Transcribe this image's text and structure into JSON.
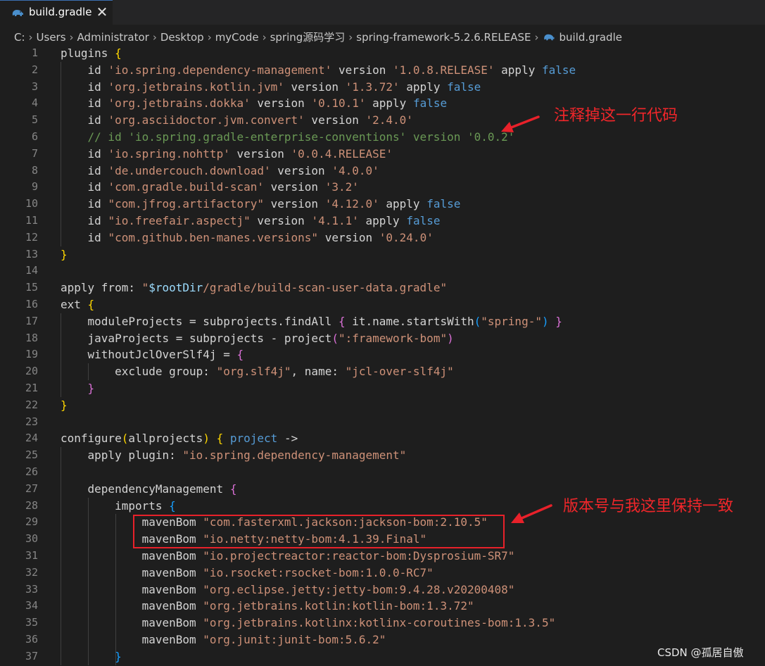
{
  "tab": {
    "file_name": "build.gradle",
    "close_glyph": "✕",
    "icon": "gradle-elephant-icon"
  },
  "breadcrumb": [
    "C:",
    "Users",
    "Administrator",
    "Desktop",
    "myCode",
    "spring源码学习",
    "spring-framework-5.2.6.RELEASE",
    "build.gradle"
  ],
  "colors": {
    "keyword": "#569cd6",
    "string": "#ce9178",
    "comment": "#6a9955",
    "annotation": "#f0262a"
  },
  "annotations": [
    {
      "text": "注释掉这一行代码",
      "target_line": 6
    },
    {
      "text": "版本号与我这里保持一致",
      "target_lines": [
        29,
        30
      ]
    }
  ],
  "watermark": "CSDN @孤居自傲",
  "code_lines": [
    [
      [
        "o",
        "plugins "
      ],
      [
        "b1",
        "{"
      ]
    ],
    [
      [
        "o",
        "    id "
      ],
      [
        "s",
        "'io.spring.dependency-management'"
      ],
      [
        "o",
        " version "
      ],
      [
        "s",
        "'1.0.8.RELEASE'"
      ],
      [
        "o",
        " apply "
      ],
      [
        "kw",
        "false"
      ]
    ],
    [
      [
        "o",
        "    id "
      ],
      [
        "s",
        "'org.jetbrains.kotlin.jvm'"
      ],
      [
        "o",
        " version "
      ],
      [
        "s",
        "'1.3.72'"
      ],
      [
        "o",
        " apply "
      ],
      [
        "kw",
        "false"
      ]
    ],
    [
      [
        "o",
        "    id "
      ],
      [
        "s",
        "'org.jetbrains.dokka'"
      ],
      [
        "o",
        " version "
      ],
      [
        "s",
        "'0.10.1'"
      ],
      [
        "o",
        " apply "
      ],
      [
        "kw",
        "false"
      ]
    ],
    [
      [
        "o",
        "    id "
      ],
      [
        "s",
        "'org.asciidoctor.jvm.convert'"
      ],
      [
        "o",
        " version "
      ],
      [
        "s",
        "'2.4.0'"
      ]
    ],
    [
      [
        "o",
        "    "
      ],
      [
        "c",
        "// id 'io.spring.gradle-enterprise-conventions' version '0.0.2'"
      ]
    ],
    [
      [
        "o",
        "    id "
      ],
      [
        "s",
        "'io.spring.nohttp'"
      ],
      [
        "o",
        " version "
      ],
      [
        "s",
        "'0.0.4.RELEASE'"
      ]
    ],
    [
      [
        "o",
        "    id "
      ],
      [
        "s",
        "'de.undercouch.download'"
      ],
      [
        "o",
        " version "
      ],
      [
        "s",
        "'4.0.0'"
      ]
    ],
    [
      [
        "o",
        "    id "
      ],
      [
        "s",
        "'com.gradle.build-scan'"
      ],
      [
        "o",
        " version "
      ],
      [
        "s",
        "'3.2'"
      ]
    ],
    [
      [
        "o",
        "    id "
      ],
      [
        "s",
        "\"com.jfrog.artifactory\""
      ],
      [
        "o",
        " version "
      ],
      [
        "s",
        "'4.12.0'"
      ],
      [
        "o",
        " apply "
      ],
      [
        "kw",
        "false"
      ]
    ],
    [
      [
        "o",
        "    id "
      ],
      [
        "s",
        "\"io.freefair.aspectj\""
      ],
      [
        "o",
        " version "
      ],
      [
        "s",
        "'4.1.1'"
      ],
      [
        "o",
        " apply "
      ],
      [
        "kw",
        "false"
      ]
    ],
    [
      [
        "o",
        "    id "
      ],
      [
        "s",
        "\"com.github.ben-manes.versions\""
      ],
      [
        "o",
        " version "
      ],
      [
        "s",
        "'0.24.0'"
      ]
    ],
    [
      [
        "b1",
        "}"
      ]
    ],
    [],
    [
      [
        "o",
        "apply from: "
      ],
      [
        "s",
        "\""
      ],
      [
        "v",
        "$rootDir"
      ],
      [
        "s",
        "/gradle/build-scan-user-data.gradle\""
      ]
    ],
    [
      [
        "o",
        "ext "
      ],
      [
        "b1",
        "{"
      ]
    ],
    [
      [
        "o",
        "    moduleProjects = subprojects.findAll "
      ],
      [
        "b2",
        "{"
      ],
      [
        "o",
        " it.name.startsWith"
      ],
      [
        "b3",
        "("
      ],
      [
        "s",
        "\"spring-\""
      ],
      [
        "b3",
        ")"
      ],
      [
        "o",
        " "
      ],
      [
        "b2",
        "}"
      ]
    ],
    [
      [
        "o",
        "    javaProjects = subprojects - project"
      ],
      [
        "b2",
        "("
      ],
      [
        "s",
        "\":framework-bom\""
      ],
      [
        "b2",
        ")"
      ]
    ],
    [
      [
        "o",
        "    withoutJclOverSlf4j = "
      ],
      [
        "b2",
        "{"
      ]
    ],
    [
      [
        "o",
        "        exclude group: "
      ],
      [
        "s",
        "\"org.slf4j\""
      ],
      [
        "o",
        ", name: "
      ],
      [
        "s",
        "\"jcl-over-slf4j\""
      ]
    ],
    [
      [
        "o",
        "    "
      ],
      [
        "b2",
        "}"
      ]
    ],
    [
      [
        "b1",
        "}"
      ]
    ],
    [],
    [
      [
        "o",
        "configure"
      ],
      [
        "b1",
        "("
      ],
      [
        "o",
        "allprojects"
      ],
      [
        "b1",
        ")"
      ],
      [
        "o",
        " "
      ],
      [
        "b1",
        "{"
      ],
      [
        "o",
        " "
      ],
      [
        "kw",
        "project"
      ],
      [
        "o",
        " ->"
      ]
    ],
    [
      [
        "o",
        "    apply plugin: "
      ],
      [
        "s",
        "\"io.spring.dependency-management\""
      ]
    ],
    [],
    [
      [
        "o",
        "    dependencyManagement "
      ],
      [
        "b2",
        "{"
      ]
    ],
    [
      [
        "o",
        "        imports "
      ],
      [
        "b3",
        "{"
      ]
    ],
    [
      [
        "o",
        "            mavenBom "
      ],
      [
        "s",
        "\"com.fasterxml.jackson:jackson-bom:2.10.5\""
      ]
    ],
    [
      [
        "o",
        "            mavenBom "
      ],
      [
        "s",
        "\"io.netty:netty-bom:4.1.39.Final\""
      ]
    ],
    [
      [
        "o",
        "            mavenBom "
      ],
      [
        "s",
        "\"io.projectreactor:reactor-bom:Dysprosium-SR7\""
      ]
    ],
    [
      [
        "o",
        "            mavenBom "
      ],
      [
        "s",
        "\"io.rsocket:rsocket-bom:1.0.0-RC7\""
      ]
    ],
    [
      [
        "o",
        "            mavenBom "
      ],
      [
        "s",
        "\"org.eclipse.jetty:jetty-bom:9.4.28.v20200408\""
      ]
    ],
    [
      [
        "o",
        "            mavenBom "
      ],
      [
        "s",
        "\"org.jetbrains.kotlin:kotlin-bom:1.3.72\""
      ]
    ],
    [
      [
        "o",
        "            mavenBom "
      ],
      [
        "s",
        "\"org.jetbrains.kotlinx:kotlinx-coroutines-bom:1.3.5\""
      ]
    ],
    [
      [
        "o",
        "            mavenBom "
      ],
      [
        "s",
        "\"org.junit:junit-bom:5.6.2\""
      ]
    ],
    [
      [
        "o",
        "        "
      ],
      [
        "b3",
        "}"
      ]
    ]
  ]
}
